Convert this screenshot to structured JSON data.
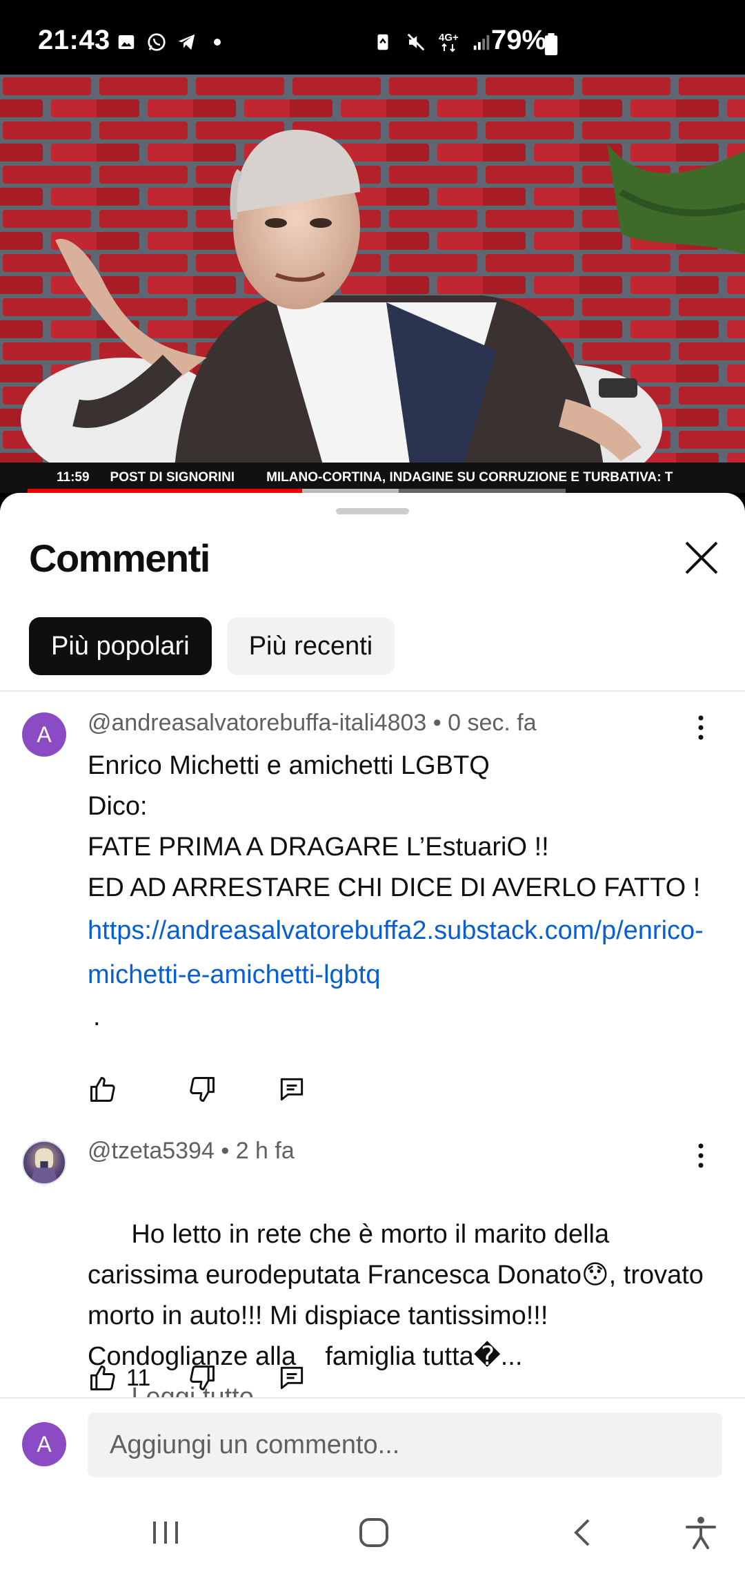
{
  "status_bar": {
    "time": "21:43",
    "battery": "79%",
    "network": "4G+",
    "icons_left": [
      "gallery-icon",
      "whatsapp-icon",
      "telegram-icon",
      "dot-icon"
    ],
    "icons_right": [
      "battery-saver-icon",
      "mute-icon",
      "data-icon",
      "signal-icon",
      "battery-icon"
    ]
  },
  "video": {
    "ticker_time": "11:59",
    "ticker_label": "POST DI SIGNORINI",
    "ticker_headline": "MILANO-CORTINA, INDAGINE SU CORRUZIONE E TURBATIVA: T",
    "progress_fraction": 0.51,
    "buffered_fraction": 0.69,
    "colors": {
      "progress": "#ee0000"
    }
  },
  "sheet": {
    "title": "Commenti",
    "close_icon": "close-icon",
    "chips": [
      {
        "label": "Più popolari",
        "active": true
      },
      {
        "label": "Più recenti",
        "active": false
      }
    ]
  },
  "comments": [
    {
      "avatar_letter": "A",
      "author": "@andreasalvatorebuffa-itali4803",
      "time": "0 sec. fa",
      "lines": [
        "Enrico Michetti e amichetti LGBTQ",
        "Dico:",
        "FATE PRIMA A DRAGARE L’EstuariO !!",
        "ED AD ARRESTARE CHI DICE DI AVERLO FATTO !"
      ],
      "link": "https://andreasalvatorebuffa2.substack.com/p/enrico-michetti-e-amichetti-lgbtq",
      "trailing": ".",
      "likes": ""
    },
    {
      "avatar_letter": "",
      "author": "@tzeta5394",
      "time": "2 h fa",
      "text": "Ho letto in rete che è morto il marito della carissima eurodeputata Francesca Donato😯, trovato morto in auto!!! Mi dispiace tantissimo!!! Condoglianze alla    famiglia tutta�...",
      "read_more": "Leggi tutto",
      "likes": "11"
    }
  ],
  "composer": {
    "avatar_letter": "A",
    "placeholder": "Aggiungi un commento..."
  },
  "nav": {
    "buttons": [
      "recents-icon",
      "home-icon",
      "back-icon",
      "accessibility-icon"
    ]
  }
}
